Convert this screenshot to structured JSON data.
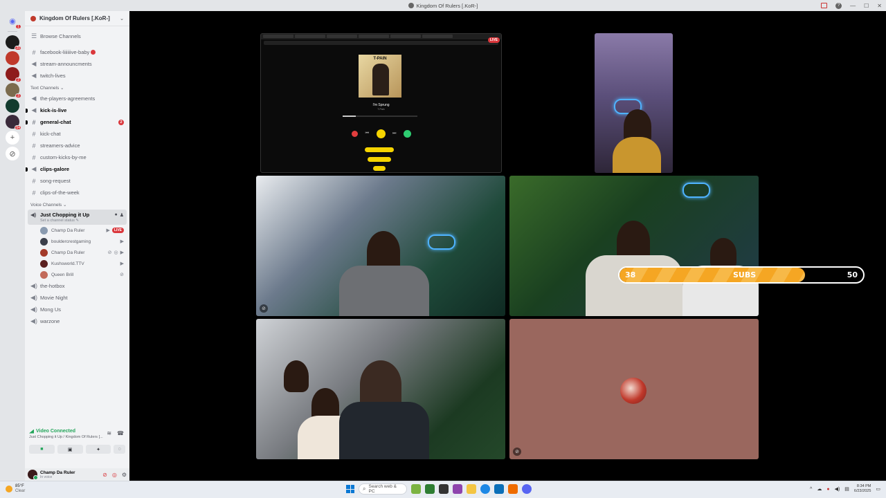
{
  "window": {
    "title": "Kingdom Of Rulers [.KoR-]"
  },
  "rail": {
    "badges": [
      "1",
      "20",
      "2",
      "3",
      "3",
      "54"
    ]
  },
  "guild": {
    "name": "Kingdom Of Rulers [.KoR-]"
  },
  "browse_channels": "Browse Channels",
  "channels_top": [
    {
      "name": "facebook-liiiiiive-baby",
      "icon": "#"
    },
    {
      "name": "stream-announcments",
      "icon": "📢"
    },
    {
      "name": "twitch-lives",
      "icon": "📢"
    }
  ],
  "text_category": "Text Channels",
  "text_channels": [
    {
      "name": "the-players-agreements",
      "icon": "📢"
    },
    {
      "name": "kick-is-live",
      "icon": "📢"
    },
    {
      "name": "general-chat",
      "icon": "#",
      "badge": "2"
    },
    {
      "name": "kick-chat",
      "icon": "#"
    },
    {
      "name": "streamers-advice",
      "icon": "#"
    },
    {
      "name": "custom-kicks-by-me",
      "icon": "#"
    },
    {
      "name": "clips-galore",
      "icon": "📢"
    },
    {
      "name": "song-request",
      "icon": "#"
    },
    {
      "name": "clips-of-the-week",
      "icon": "#"
    }
  ],
  "voice_category": "Voice Channels",
  "voice_active": {
    "name": "Just Chopping it Up",
    "status_hint": "Set a channel status"
  },
  "voice_users": [
    {
      "name": "Champ Da Ruler",
      "live": "LIVE",
      "color": "#8a9bb0"
    },
    {
      "name": "bouldercrestgaming",
      "color": "#3b3f4a"
    },
    {
      "name": "Champ Da Ruler",
      "color": "#a33a2a"
    },
    {
      "name": "Kushsworld.TTV",
      "color": "#5a1f1f"
    },
    {
      "name": "Queen Brill",
      "color": "#c26a5a"
    }
  ],
  "voice_channels": [
    {
      "name": "the-hotbox"
    },
    {
      "name": "Movie Night"
    },
    {
      "name": "Mong Us"
    },
    {
      "name": "warzone"
    }
  ],
  "voice_panel": {
    "status": "Video Connected",
    "location": "Just Chopping it Up / Kingdom Of Rulers [..."
  },
  "user": {
    "name": "Champ Da Ruler",
    "state": "In voice"
  },
  "screenshare": {
    "live": "LIVE",
    "album_label": "T-PAIN",
    "song": "I'm Sprung",
    "artist": "T-Pain",
    "progress": 0.18
  },
  "sub_goal": {
    "current": "38",
    "label": "SUBS",
    "goal": "50",
    "fraction": 0.76
  },
  "taskbar": {
    "temp": "85°F",
    "weather": "Clear",
    "search_placeholder": "Search web & PC",
    "time": "8:34 PM",
    "date": "6/23/2025"
  }
}
